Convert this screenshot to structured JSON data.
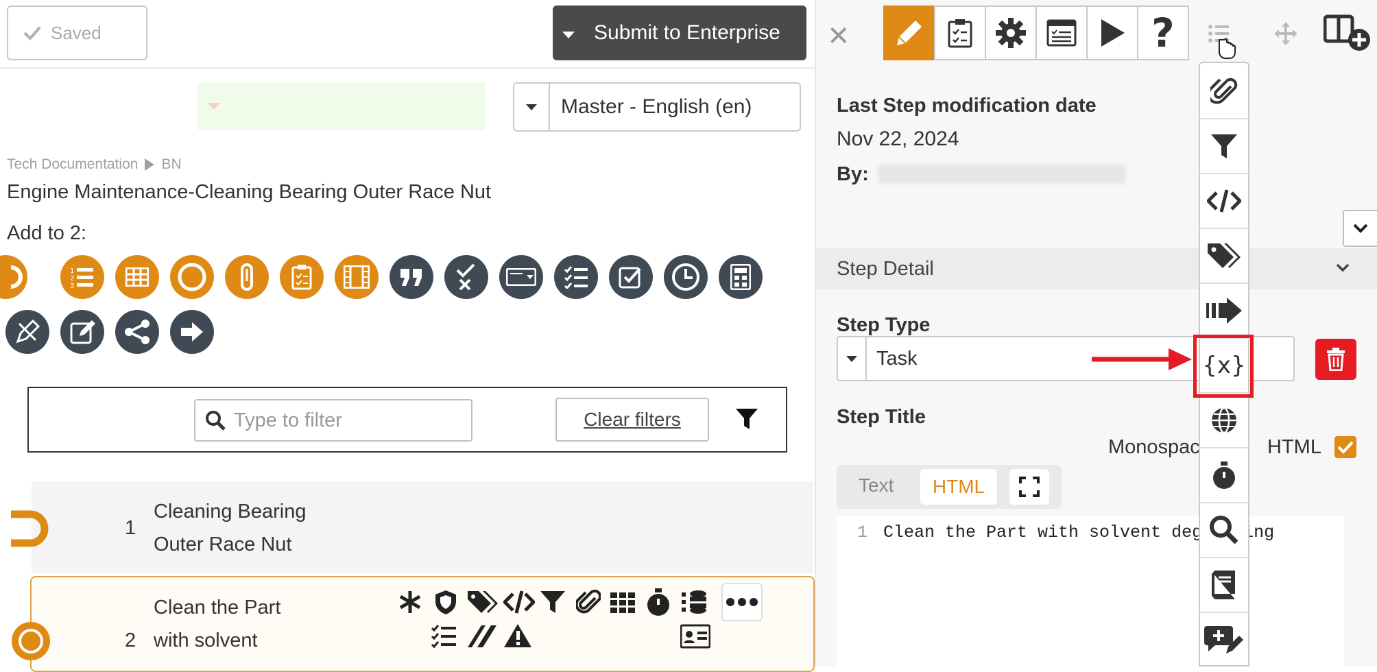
{
  "header": {
    "saved_label": "Saved",
    "submit_label": "Submit to Enterprise",
    "language_select": "Master - English (en)"
  },
  "breadcrumb": {
    "parent": "Tech Documentation",
    "child": "BN"
  },
  "document": {
    "title": "Engine Maintenance-Cleaning Bearing Outer Race Nut",
    "add_to_label": "Add to 2:"
  },
  "add_icons": [
    {
      "icon": "step-half-circle-icon",
      "color": "#e08a16"
    },
    {
      "icon": "numbered-list-icon",
      "color": "#e08a16"
    },
    {
      "icon": "table-icon",
      "color": "#e08a16"
    },
    {
      "icon": "circle-icon",
      "color": "#e08a16"
    },
    {
      "icon": "paperclip-link-icon",
      "color": "#e08a16"
    },
    {
      "icon": "checklist-clipboard-icon",
      "color": "#e08a16"
    },
    {
      "icon": "film-icon",
      "color": "#e08a16"
    },
    {
      "icon": "quote-icon",
      "color": "#3f4a54"
    },
    {
      "icon": "check-cross-icon",
      "color": "#3f4a54"
    },
    {
      "icon": "dropdown-field-icon",
      "color": "#3f4a54"
    },
    {
      "icon": "task-list-icon",
      "color": "#3f4a54"
    },
    {
      "icon": "checkbox-icon",
      "color": "#3f4a54"
    },
    {
      "icon": "clock-icon",
      "color": "#3f4a54"
    },
    {
      "icon": "calculator-icon",
      "color": "#3f4a54"
    },
    {
      "icon": "pencil-ruler-icon",
      "color": "#3f4a54"
    },
    {
      "icon": "edit-note-icon",
      "color": "#3f4a54"
    },
    {
      "icon": "branch-share-icon",
      "color": "#3f4a54"
    },
    {
      "icon": "arrow-right-icon",
      "color": "#3f4a54"
    }
  ],
  "filter": {
    "placeholder": "Type to filter",
    "clear_label": "Clear filters"
  },
  "steps": [
    {
      "number": "1",
      "line1": "Cleaning Bearing",
      "line2": "Outer Race Nut"
    },
    {
      "number": "2",
      "line1": "Clean the Part",
      "line2": "with solvent"
    }
  ],
  "right_panel": {
    "last_mod_label": "Last Step modification date",
    "last_mod_date": "Nov 22, 2024",
    "by_label": "By:",
    "section_title": "Step Detail",
    "step_type_label": "Step Type",
    "step_type_value": "Task",
    "step_title_label": "Step Title",
    "monospace_label": "Monospace",
    "html_label": "HTML",
    "tab_text": "Text",
    "tab_html": "HTML",
    "code_line_no": "1",
    "code_text": "Clean the Part with solvent degreasing"
  },
  "colors": {
    "accent_orange": "#e08a16",
    "dark_icon": "#3f4a54",
    "danger_red": "#e51c23"
  }
}
